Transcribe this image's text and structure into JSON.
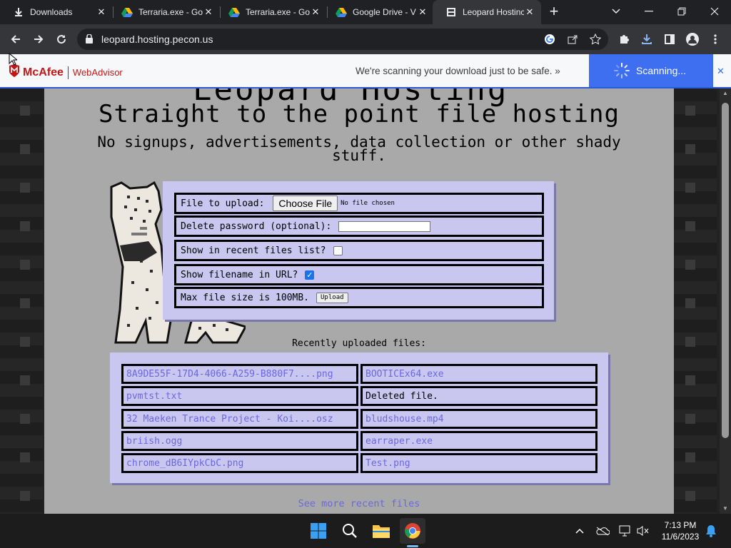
{
  "browser": {
    "tabs": [
      {
        "title": "Downloads",
        "icon": "download-icon",
        "active": false
      },
      {
        "title": "Terraria.exe - Go",
        "icon": "google-drive-icon",
        "active": false
      },
      {
        "title": "Terraria.exe - Go",
        "icon": "google-drive-icon",
        "active": false
      },
      {
        "title": "Google Drive - V",
        "icon": "google-drive-icon",
        "active": false
      },
      {
        "title": "Leopard Hostinc",
        "icon": "page-icon",
        "active": true
      }
    ],
    "url": "leopard.hosting.pecon.us"
  },
  "mcafee": {
    "brand": "McAfee",
    "product": "WebAdvisor",
    "message": "We're scanning your download just to be safe. »",
    "status": "Scanning...",
    "accent": "#3e6ff1",
    "brand_color": "#c01818"
  },
  "page": {
    "logo_text": "Leopard Hosting",
    "tagline": "Straight to the point file hosting",
    "subtitle": "No signups, advertisements, data collection or other shady stuff.",
    "form": {
      "file_label": "File to upload:",
      "choose_file": "Choose File",
      "no_file": "No file chosen",
      "password_label": "Delete password (optional):",
      "recent_label": "Show in recent files list?",
      "recent_checked": false,
      "filename_label": "Show filename in URL?",
      "filename_checked": true,
      "max_size": "Max file size is 100MB.",
      "upload": "Upload"
    },
    "recent_title": "Recently uploaded files:",
    "recent_files": [
      {
        "name": "8A9DE55F-17D4-4066-A259-B880F7....png",
        "link": true
      },
      {
        "name": "BOOTICEx64.exe",
        "link": true
      },
      {
        "name": "pvmtst.txt",
        "link": true
      },
      {
        "name": "Deleted file.",
        "link": false
      },
      {
        "name": "32 Maeken Trance Project - Koi....osz",
        "link": true
      },
      {
        "name": "bludshouse.mp4",
        "link": true
      },
      {
        "name": "briish.ogg",
        "link": true
      },
      {
        "name": "earraper.exe",
        "link": true
      },
      {
        "name": "chrome_dB6IYpkCbC.png",
        "link": true
      },
      {
        "name": "Test.png",
        "link": true
      }
    ],
    "see_more": "See more recent files",
    "link_color": "#6b67e0",
    "panel_color": "#c9c7f0"
  },
  "taskbar": {
    "apps": [
      "windows-start-icon",
      "search-icon",
      "file-explorer-icon",
      "chrome-icon"
    ],
    "time": "7:13 PM",
    "date": "11/6/2023"
  }
}
